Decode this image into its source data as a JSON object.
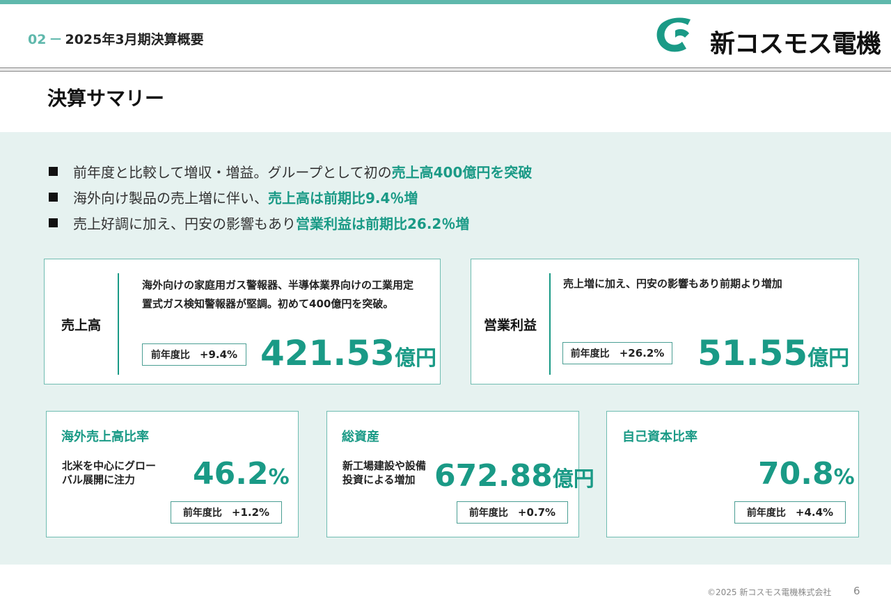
{
  "header": {
    "section_num": "02",
    "section_dash": "－",
    "section_title": "2025年3月期決算概要",
    "company_name": "新コスモス電機",
    "accent_color": "#5fb8ac"
  },
  "page_title": "決算サマリー",
  "bullets": [
    {
      "text": "前年度と比較して増収・増益。グループとして初の",
      "highlight": "売上高400億円を突破"
    },
    {
      "text": "海外向け製品の売上増に伴い、",
      "highlight": "売上高は前期比9.4％増"
    },
    {
      "text": "売上好調に加え、円安の影響もあり",
      "highlight": "営業利益は前期比26.2％増"
    }
  ],
  "sales_card": {
    "label": "売上高",
    "description": "海外向けの家庭用ガス警報器、半導体業界向けの工業用定置式ガス検知警報器が堅調。初めて400億円を突破。",
    "yoy_label": "前年度比",
    "yoy_value": "+9.4%",
    "value": "421.53",
    "unit": "億円"
  },
  "op_card": {
    "label": "営業利益",
    "description": "売上増に加え、円安の影響もあり前期より増加",
    "yoy_label": "前年度比",
    "yoy_value": "+26.2%",
    "value": "51.55",
    "unit": "億円"
  },
  "overseas_card": {
    "title": "海外売上高比率",
    "description": "北米を中心にグローバル展開に注力",
    "value": "46.2",
    "unit": "%",
    "yoy_label": "前年度比",
    "yoy_value": "+1.2%"
  },
  "assets_card": {
    "title": "総資産",
    "description": "新工場建設や設備投資による増加",
    "value": "672.88",
    "unit": "億円",
    "yoy_label": "前年度比",
    "yoy_value": "+0.7%"
  },
  "equity_card": {
    "title": "自己資本比率",
    "value": "70.8",
    "unit": "%",
    "yoy_label": "前年度比",
    "yoy_value": "+4.4%"
  },
  "footer": {
    "copyright": "©2025 新コスモス電機株式会社",
    "page": "6"
  }
}
